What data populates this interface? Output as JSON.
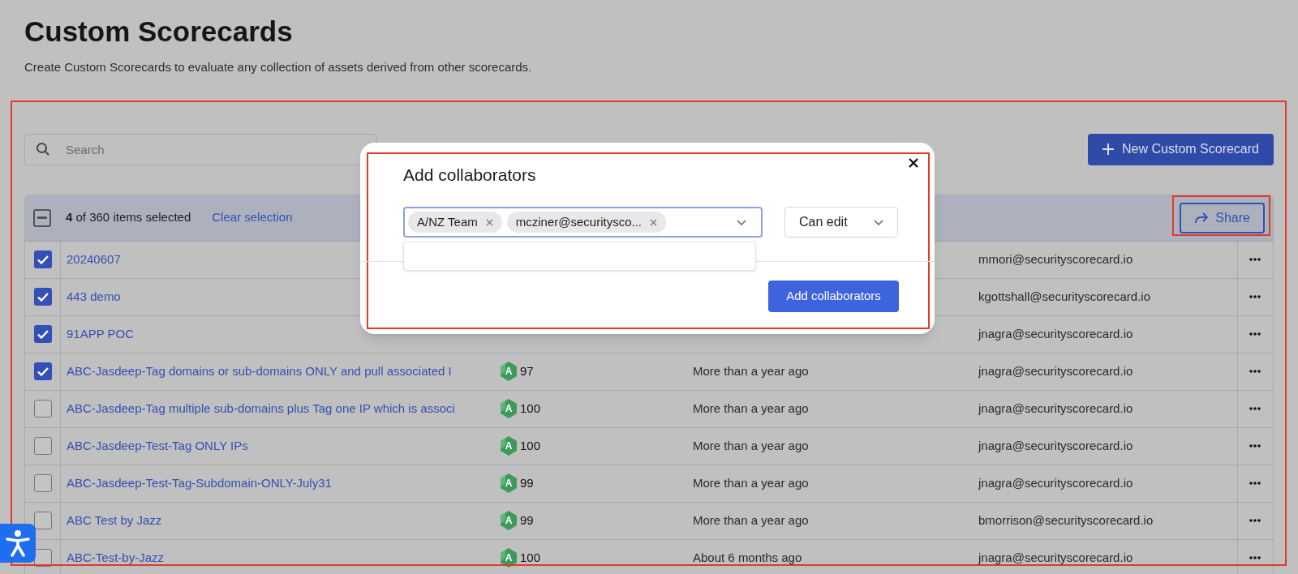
{
  "page": {
    "title": "Custom Scorecards",
    "subtitle": "Create Custom Scorecards to evaluate any collection of assets derived from other scorecards."
  },
  "search": {
    "placeholder": "Search"
  },
  "new_button": {
    "label": "New Custom Scorecard"
  },
  "selection_bar": {
    "indeterminate": true,
    "text": "**4** of 360 items selected",
    "clear_link": "Clear selection",
    "share_button": "Share"
  },
  "rows": [
    {
      "checked": true,
      "name": "20240607",
      "owner": "mmori@securityscorecard.io"
    },
    {
      "checked": true,
      "name": "443 demo",
      "owner": "kgottshall@securityscorecard.io"
    },
    {
      "checked": true,
      "name": "91APP POC",
      "owner": "jnagra@securityscorecard.io"
    },
    {
      "checked": true,
      "name": "ABC-Jasdeep-Tag domains or sub-domains ONLY and pull associated I",
      "grade": "A",
      "score": "97",
      "updated": "More than a year ago",
      "owner": "jnagra@securityscorecard.io"
    },
    {
      "checked": false,
      "name": "ABC-Jasdeep-Tag multiple sub-domains plus Tag one IP which is associ",
      "grade": "A",
      "score": "100",
      "updated": "More than a year ago",
      "owner": "jnagra@securityscorecard.io"
    },
    {
      "checked": false,
      "name": "ABC-Jasdeep-Test-Tag ONLY IPs",
      "grade": "A",
      "score": "100",
      "updated": "More than a year ago",
      "owner": "jnagra@securityscorecard.io"
    },
    {
      "checked": false,
      "name": "ABC-Jasdeep-Test-Tag-Subdomain-ONLY-July31",
      "grade": "A",
      "score": "99",
      "updated": "More than a year ago",
      "owner": "jnagra@securityscorecard.io"
    },
    {
      "checked": false,
      "name": "ABC Test by Jazz",
      "grade": "A",
      "score": "99",
      "updated": "More than a year ago",
      "owner": "bmorrison@securityscorecard.io"
    },
    {
      "checked": false,
      "name": "ABC-Test-by-Jazz",
      "grade": "A",
      "score": "100",
      "updated": "About 6 months ago",
      "owner": "jnagra@securityscorecard.io"
    }
  ],
  "dialog": {
    "title": "Add collaborators",
    "chips": [
      "A/NZ Team",
      "mcziner@securitysco..."
    ],
    "permission": "Can edit",
    "submit": "Add collaborators"
  }
}
